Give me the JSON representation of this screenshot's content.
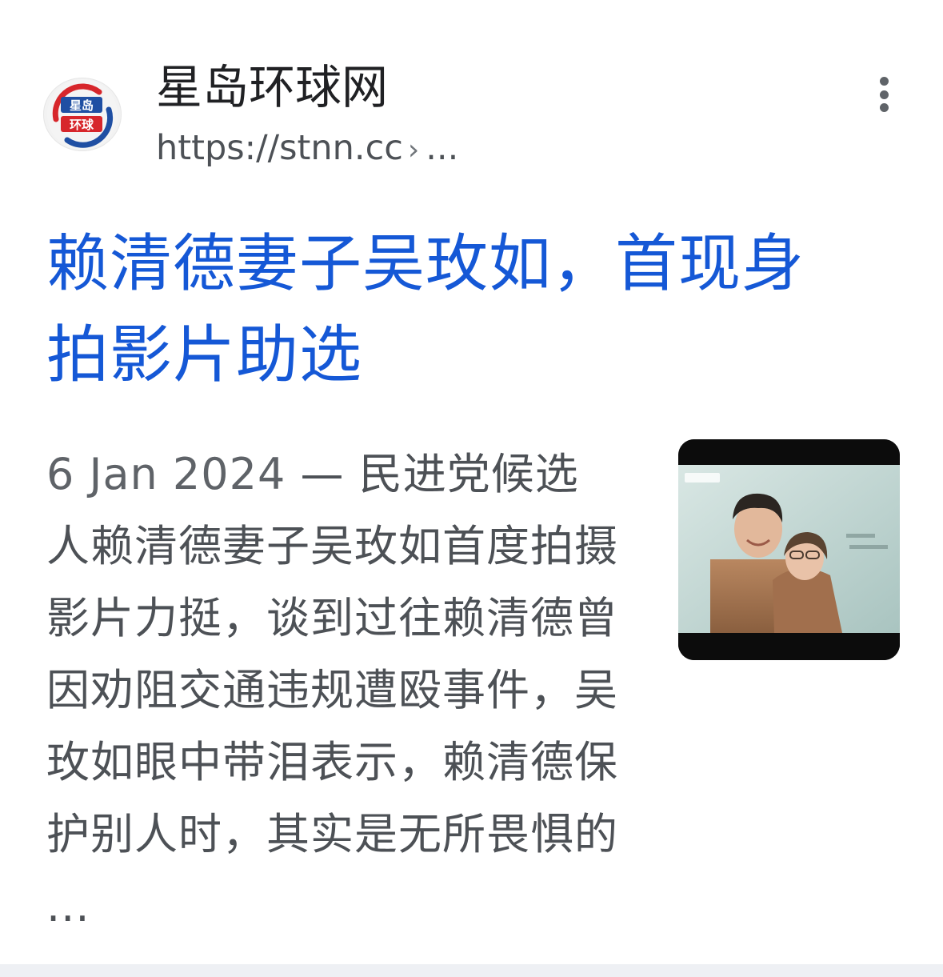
{
  "source": {
    "logo_icon": "stnn-logo-icon",
    "logo_text_top": "星岛",
    "logo_text_bottom": "环球",
    "name": "星岛环球网",
    "url": "https://stnn.cc",
    "url_separator": "›",
    "url_ellipsis": "..."
  },
  "menu": {
    "icon": "more-vert-icon"
  },
  "result": {
    "title": "赖清德妻子吴玫如，首现身拍影片助选",
    "date": "6 Jan 2024",
    "date_separator": " — ",
    "snippet": "民进党候选人赖清德妻子吴玫如首度拍摄影片力挺，谈到过往赖清德曾因劝阻交通违规遭殴事件，吴玫如眼中带泪表示，赖清德保护别人时，其实是无所畏惧的 ..."
  },
  "thumbnail": {
    "icon": "video-thumbnail-image"
  },
  "colors": {
    "title_link": "#1558d6",
    "text_primary": "#202124",
    "text_secondary": "#4d5156",
    "logo_red": "#d7262b",
    "logo_blue": "#1f4fa3"
  }
}
